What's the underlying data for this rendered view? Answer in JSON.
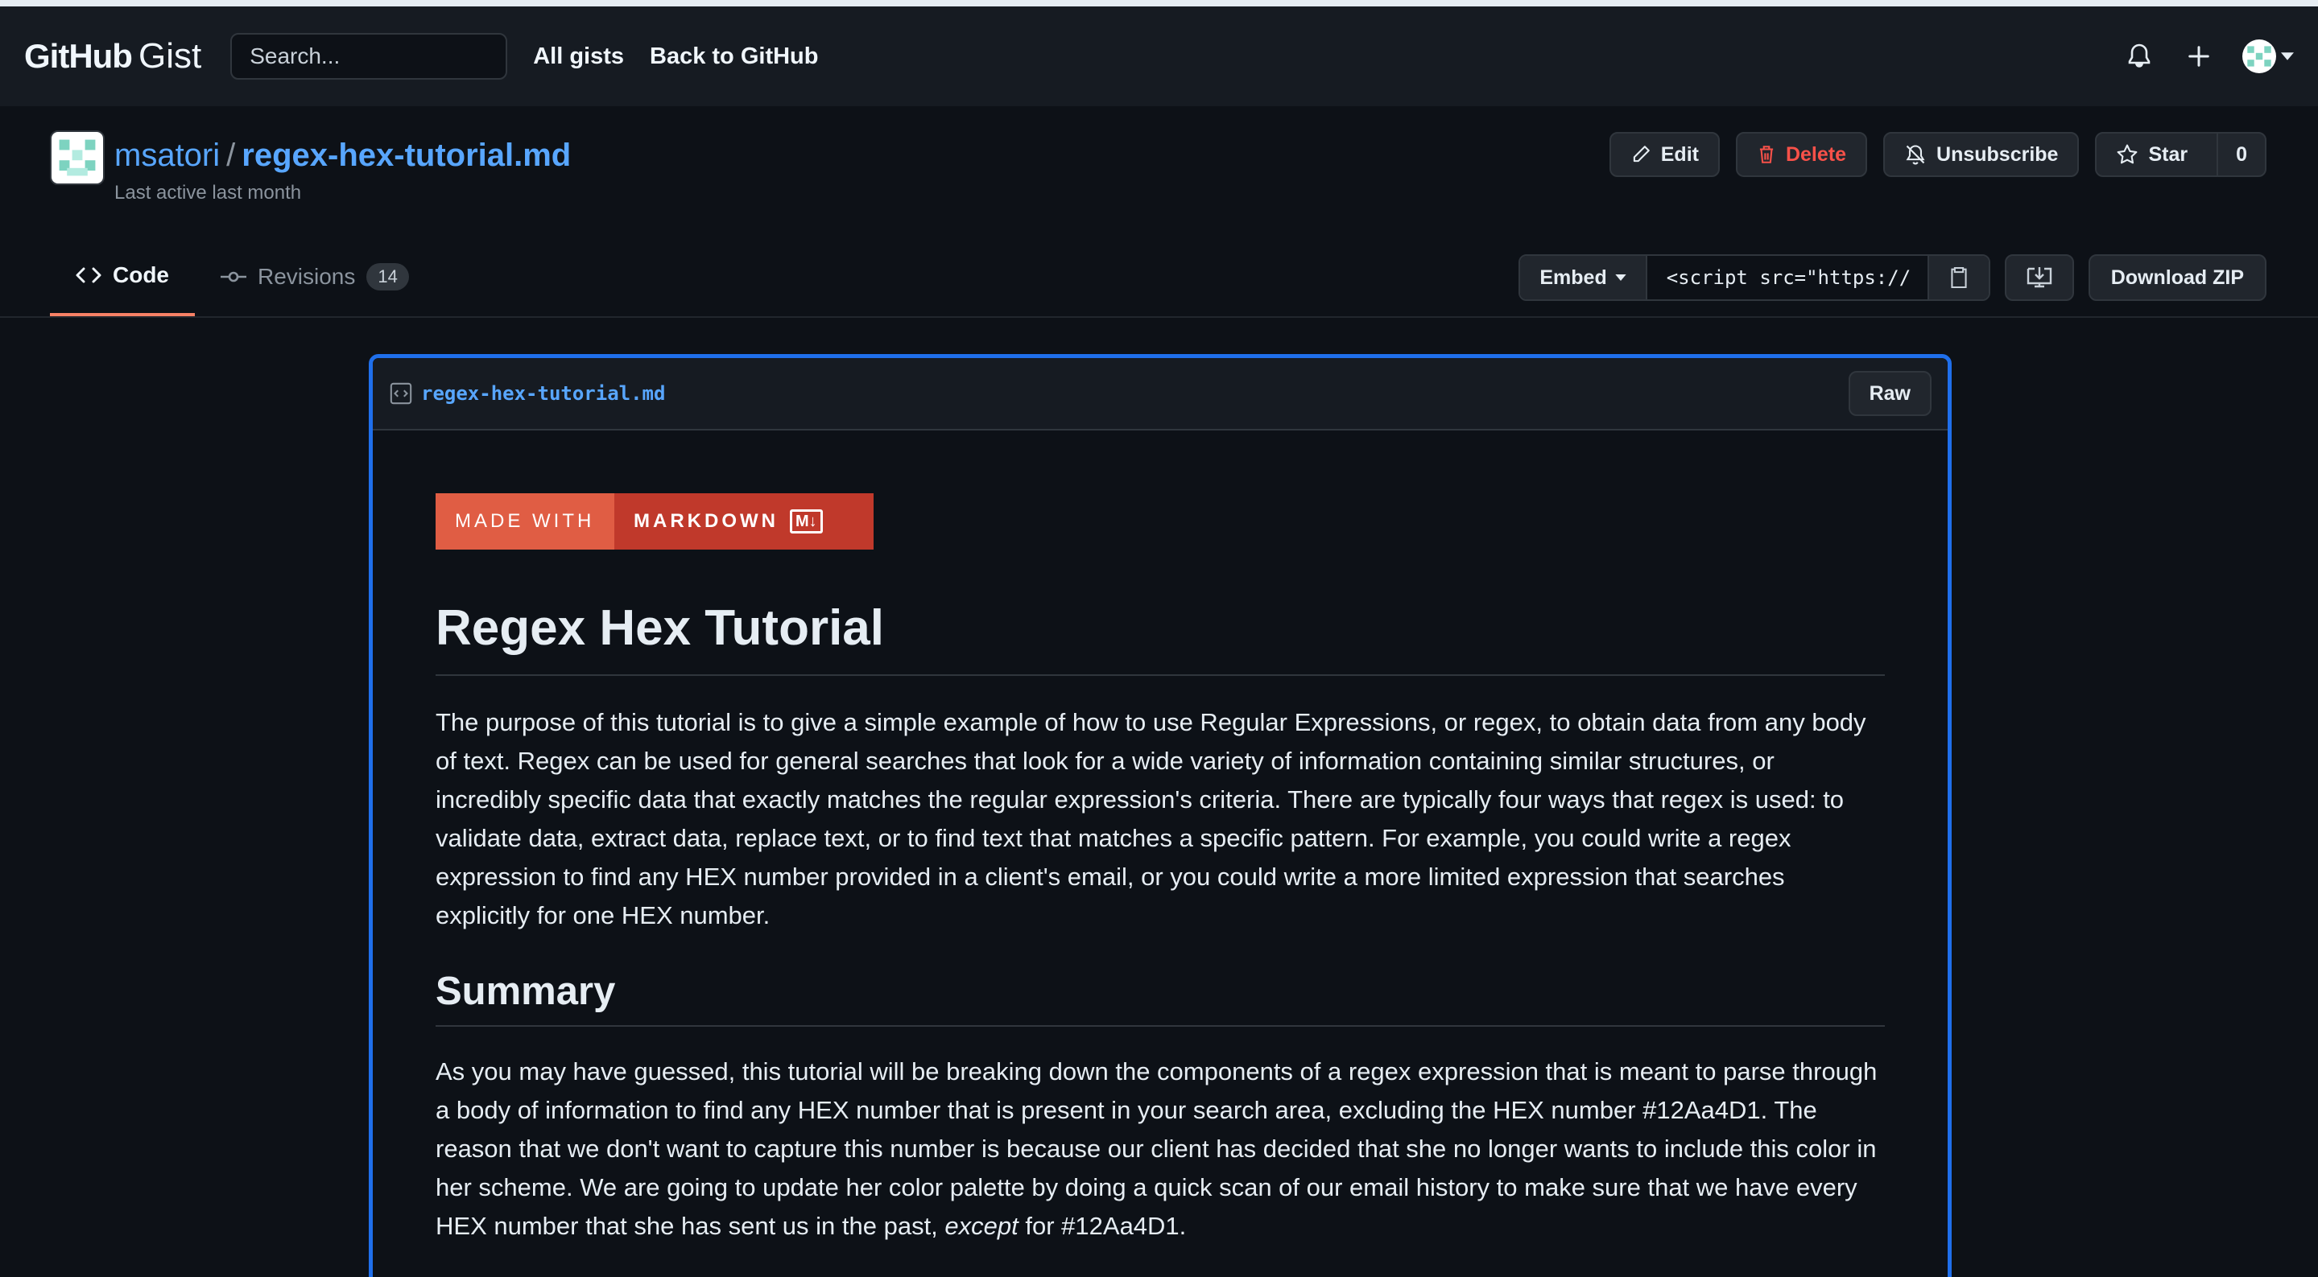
{
  "header": {
    "logo_bold": "GitHub",
    "logo_light": "Gist",
    "search_placeholder": "Search...",
    "links": [
      "All gists",
      "Back to GitHub"
    ],
    "icons": [
      "bell-icon",
      "plus-icon",
      "avatar-icon",
      "caret-down-icon"
    ]
  },
  "gist": {
    "owner": "msatori",
    "separator": "/",
    "filename": "regex-hex-tutorial.md",
    "last_active": "Last active last month"
  },
  "actions": {
    "edit": "Edit",
    "delete": "Delete",
    "unsubscribe": "Unsubscribe",
    "star": "Star",
    "star_count": "0"
  },
  "tabs": {
    "code": "Code",
    "revisions": "Revisions",
    "revisions_count": "14"
  },
  "embed": {
    "label": "Embed",
    "value": "<script src=\"https://",
    "download_zip": "Download ZIP"
  },
  "file": {
    "name": "regex-hex-tutorial.md",
    "raw": "Raw"
  },
  "markdown": {
    "badge_left": "MADE WITH",
    "badge_right": "MARKDOWN",
    "badge_mark": "M↓",
    "h1": "Regex Hex Tutorial",
    "intro": "The purpose of this tutorial is to give a simple example of how to use Regular Expressions, or regex, to obtain data from any body of text. Regex can be used for general searches that look for a wide variety of information containing similar structures, or incredibly specific data that exactly matches the regular expression's criteria. There are typically four ways that regex is used: to validate data, extract data, replace text, or to find text that matches a specific pattern. For example, you could write a regex expression to find any HEX number provided in a client's email, or you could write a more limited expression that searches explicitly for one HEX number.",
    "h2": "Summary",
    "summary_before": "As you may have guessed, this tutorial will be breaking down the components of a regex expression that is meant to parse through a body of information to find any HEX number that is present in your search area, excluding the HEX number #12Aa4D1. The reason that we don't want to capture this number is because our client has decided that she no longer wants to include this color in her scheme. We are going to update her color palette by doing a quick scan of our email history to make sure that we have every HEX number that she has sent us in the past, ",
    "summary_em": "except",
    "summary_after": " for #12Aa4D1."
  },
  "colors": {
    "accent_blue": "#58a6ff",
    "focus_border": "#1f6feb",
    "tab_underline": "#f78166",
    "danger": "#f85149",
    "badge_left": "#e05d44",
    "badge_right": "#c0392b"
  }
}
